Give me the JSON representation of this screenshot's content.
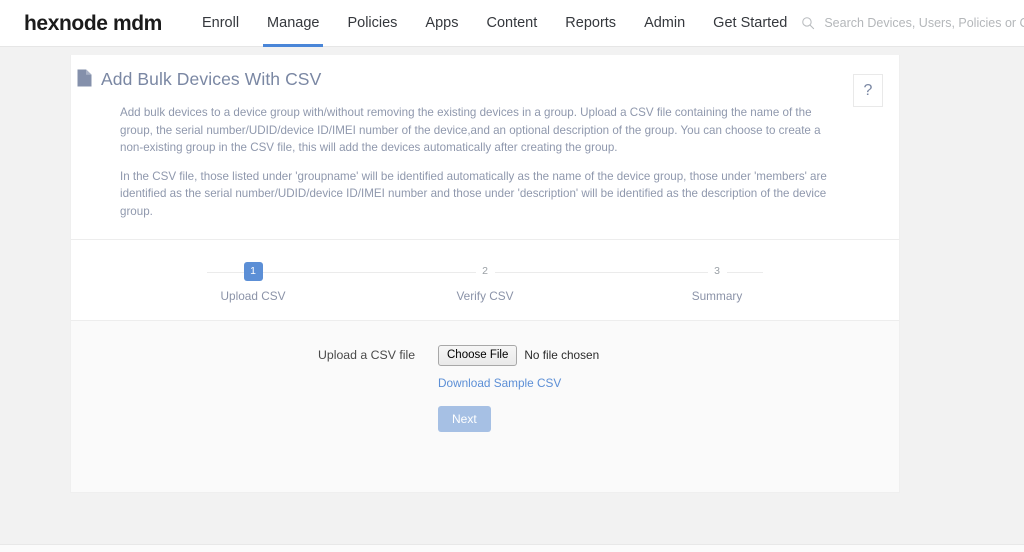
{
  "header": {
    "logo": "hexnode mdm",
    "nav": [
      {
        "label": "Enroll",
        "active": false
      },
      {
        "label": "Manage",
        "active": true
      },
      {
        "label": "Policies",
        "active": false
      },
      {
        "label": "Apps",
        "active": false
      },
      {
        "label": "Content",
        "active": false
      },
      {
        "label": "Reports",
        "active": false
      },
      {
        "label": "Admin",
        "active": false
      },
      {
        "label": "Get Started",
        "active": false
      }
    ],
    "search": {
      "icon": "search-icon",
      "placeholder": "Search Devices, Users, Policies or Content",
      "value": ""
    },
    "accent_color": "#4a86d8"
  },
  "card": {
    "title": "Add Bulk Devices With CSV",
    "title_icon": "document-icon",
    "help_label": "?",
    "description": [
      "Add bulk devices to a device group with/without removing the existing devices in a group. Upload a CSV file containing the name of the group, the serial number/UDID/device ID/IMEI number of the device,and an optional description of the group. You can choose to create a non-existing group in the CSV file, this will add the devices automatically after creating the group.",
      "In the CSV file, those listed under 'groupname' will be identified automatically as the name of the device group, those under 'members' are identified as the serial number/UDID/device ID/IMEI number and those under 'description' will be identified as the description of the device group."
    ]
  },
  "stepper": {
    "steps": [
      {
        "number": "1",
        "label": "Upload CSV",
        "active": true
      },
      {
        "number": "2",
        "label": "Verify CSV",
        "active": false
      },
      {
        "number": "3",
        "label": "Summary",
        "active": false
      }
    ],
    "active_color": "#5c8fd6"
  },
  "form": {
    "upload_label": "Upload a CSV file",
    "choose_file_label": "Choose File",
    "file_status": "No file chosen",
    "sample_link": "Download Sample CSV",
    "next_label": "Next",
    "next_color": "#a6c0e4"
  }
}
